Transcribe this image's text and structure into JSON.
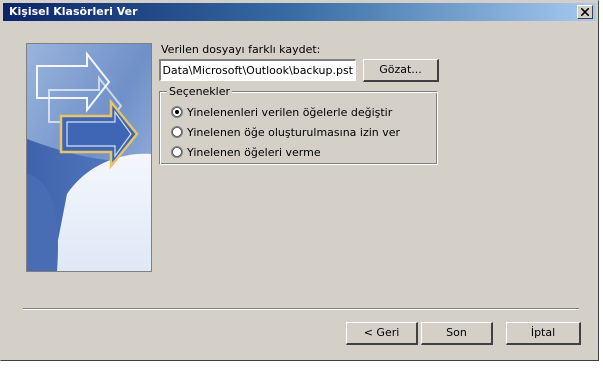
{
  "window": {
    "title": "Kişisel Klasörleri Ver"
  },
  "form": {
    "save_label": "Verilen dosyayı farklı kaydet:",
    "path_value": "ion Data\\Microsoft\\Outlook\\backup.pst",
    "browse_label": "Gözat..."
  },
  "options": {
    "legend": "Seçenekler",
    "items": [
      {
        "label": "Yinelenenleri verilen öğelerle değiştir",
        "selected": true
      },
      {
        "label": "Yinelenen öğe oluşturulmasına izin ver",
        "selected": false
      },
      {
        "label": "Yinelenen öğeleri verme",
        "selected": false
      }
    ]
  },
  "footer": {
    "back_label": "< Geri",
    "finish_label": "Son",
    "cancel_label": "İptal"
  },
  "colors": {
    "dialog_face": "#d4d0c8",
    "title_start": "#0a246a",
    "title_end": "#a6caf0"
  },
  "icons": {
    "close": "close-icon",
    "wizard_art": "wizard-arrows-icon",
    "radio": "radio-icon"
  }
}
